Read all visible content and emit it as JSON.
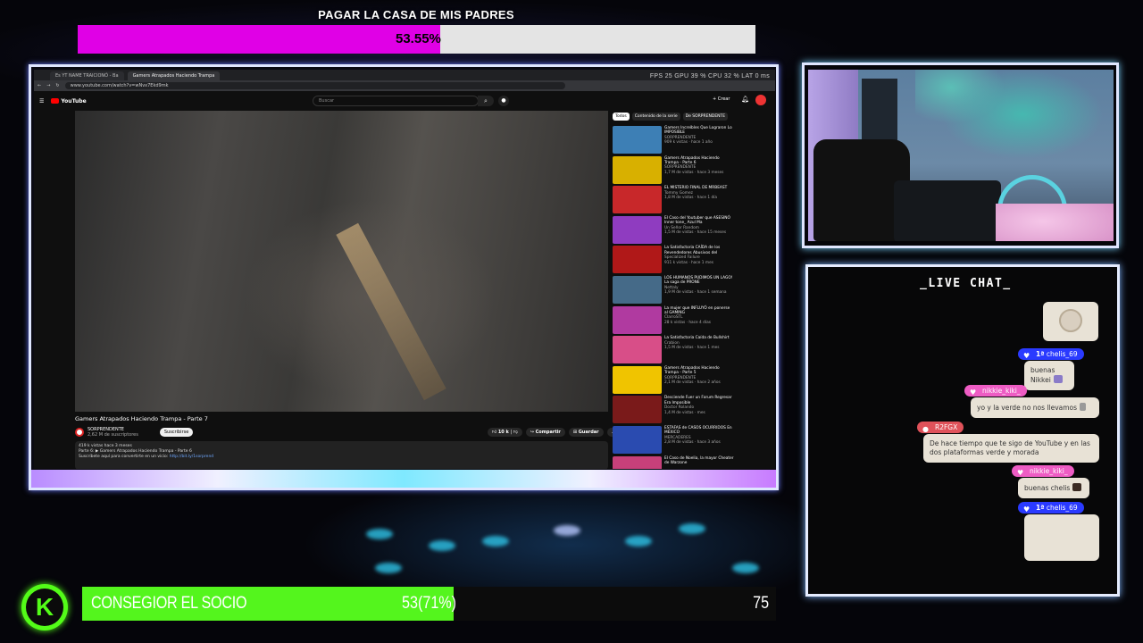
{
  "goal": {
    "title": "PAGAR LA CASA DE MIS PADRES",
    "percent": "53.55%",
    "fill": 0.5355,
    "fill_color": "#e000e6"
  },
  "browser": {
    "tabs": [
      "Es YT NAME TRAICIONÓ - Ba",
      "Gamers Atrapados Haciendo Trampa"
    ],
    "url": "www.youtube.com/watch?v=wNvx7Ekd9mk",
    "perf": "FPS  25   GPU  39 %   CPU  32 %   LAT  0 ms"
  },
  "youtube": {
    "logo": "YouTube",
    "search_placeholder": "Buscar",
    "create": "+ Crear",
    "video_title": "Gamers Atrapados Haciendo Trampa - Parte 7",
    "channel": "SORPRENDENTE",
    "subs": "2,62 M de suscriptores",
    "subscribe": "Suscribirse",
    "like": "10 k",
    "share": "Compartir",
    "save": "Guardar",
    "desc_line1": "419 k vistas  hace 3 meses",
    "desc_line2": "Parte 6: ▶ Gamers Atrapados Haciendo Trampa - Parte 6",
    "desc_line3": "Suscríbete aquí para convertirte en un vicio: ",
    "desc_link": "http://bit.ly/1sorprend",
    "chips": [
      "Todos",
      "Contenido de la serie",
      "De SORPRENDENTE"
    ],
    "recs": [
      {
        "title": "Gamers Increíbles Que Lograron Lo IMPOSIBLE",
        "channel": "SORPRENDENTE",
        "stats": "909 k vistas · hace 1 año",
        "color": "#3d7fb5"
      },
      {
        "title": "Gamers Atrapados Haciendo Trampa - Parte 6",
        "channel": "SORPRENDENTE",
        "stats": "1,7 M de vistas · hace 3 meses",
        "color": "#d8b000"
      },
      {
        "title": "EL MISTERIO FINAL DE MRBEAST",
        "channel": "Tommy Gomez",
        "stats": "1,8 M de vistas · hace 1 día",
        "color": "#c8282a"
      },
      {
        "title": "El Caso del Youtuber que ASESINÓ Inner tone_ Azul Ma",
        "channel": "Un Señor Random",
        "stats": "1,5 M de vistas · hace 15 meses",
        "color": "#8f3cc0"
      },
      {
        "title": "La Satisfactoria CAÍDA de los Revendedores Abusivos del",
        "channel": "Specialized Failure",
        "stats": "911 k vistas · hace 1 mes",
        "color": "#b01818"
      },
      {
        "title": "LOS HUMANOS PUDIMOS UN LAGO! La saga de PRONE",
        "channel": "Nettaly",
        "stats": "1,9 M de vistas · hace 1 semana",
        "color": "#456a88"
      },
      {
        "title": "La mujer que INFLUYÓ en ponerse al GAMING",
        "channel": "ClarroSTL",
        "stats": "28 k vistas · hace 4 días",
        "color": "#b03aa0"
      },
      {
        "title": "La Satisfactoria Caída de Bullshirt",
        "channel": "Crabion",
        "stats": "1,5 M de vistas · hace 1 mes",
        "color": "#d84e88"
      },
      {
        "title": "Gamers Atrapados Haciendo Trampa - Parte 5",
        "channel": "SORPRENDENTE",
        "stats": "2,1 M de vistas · hace 2 años",
        "color": "#f0c400"
      },
      {
        "title": "Desciende Fuer un Forum Regresar Era Imposible",
        "channel": "Doctor Rolando",
        "stats": "1,4 M de vistas · mes",
        "color": "#7a1a1a"
      },
      {
        "title": "ESTAFAS de CASOS OCURRIDOS En MÉXICO",
        "channel": "MERCADERES",
        "stats": "2,8 M de vistas · hace 3 años",
        "color": "#2a4bb0"
      },
      {
        "title": "El Caso de Noelia, la mayor Cheater de Warzone",
        "channel": "",
        "stats": "",
        "color": "#c7407a"
      }
    ]
  },
  "chat": {
    "title": "_LIVE CHAT_",
    "messages": [
      {
        "user": "chelis_69",
        "badge": "1ª",
        "text": "buenas Nikkei",
        "emote_color": "#8a7bc8"
      },
      {
        "user": "nikkie_kiki_",
        "text": "yo y la verde no nos llevamos",
        "emote_color": "#999"
      },
      {
        "user": "R2FGX",
        "text": "De hace tiempo que te sigo de YouTube y en las dos plataformas verde y morada"
      },
      {
        "user": "nikkie_kiki_",
        "text": "buenas chelis",
        "emote_color": "#3a2a22"
      },
      {
        "user": "chelis_69",
        "badge": "1ª",
        "text": ""
      }
    ]
  },
  "socio": {
    "label": "CONSEGIOR EL SOCIO",
    "count": "53(71%)",
    "target": "75",
    "fill": 0.71,
    "fill_color": "#54f51d"
  },
  "kick": {
    "letter": "K",
    "color": "#53fc18"
  }
}
